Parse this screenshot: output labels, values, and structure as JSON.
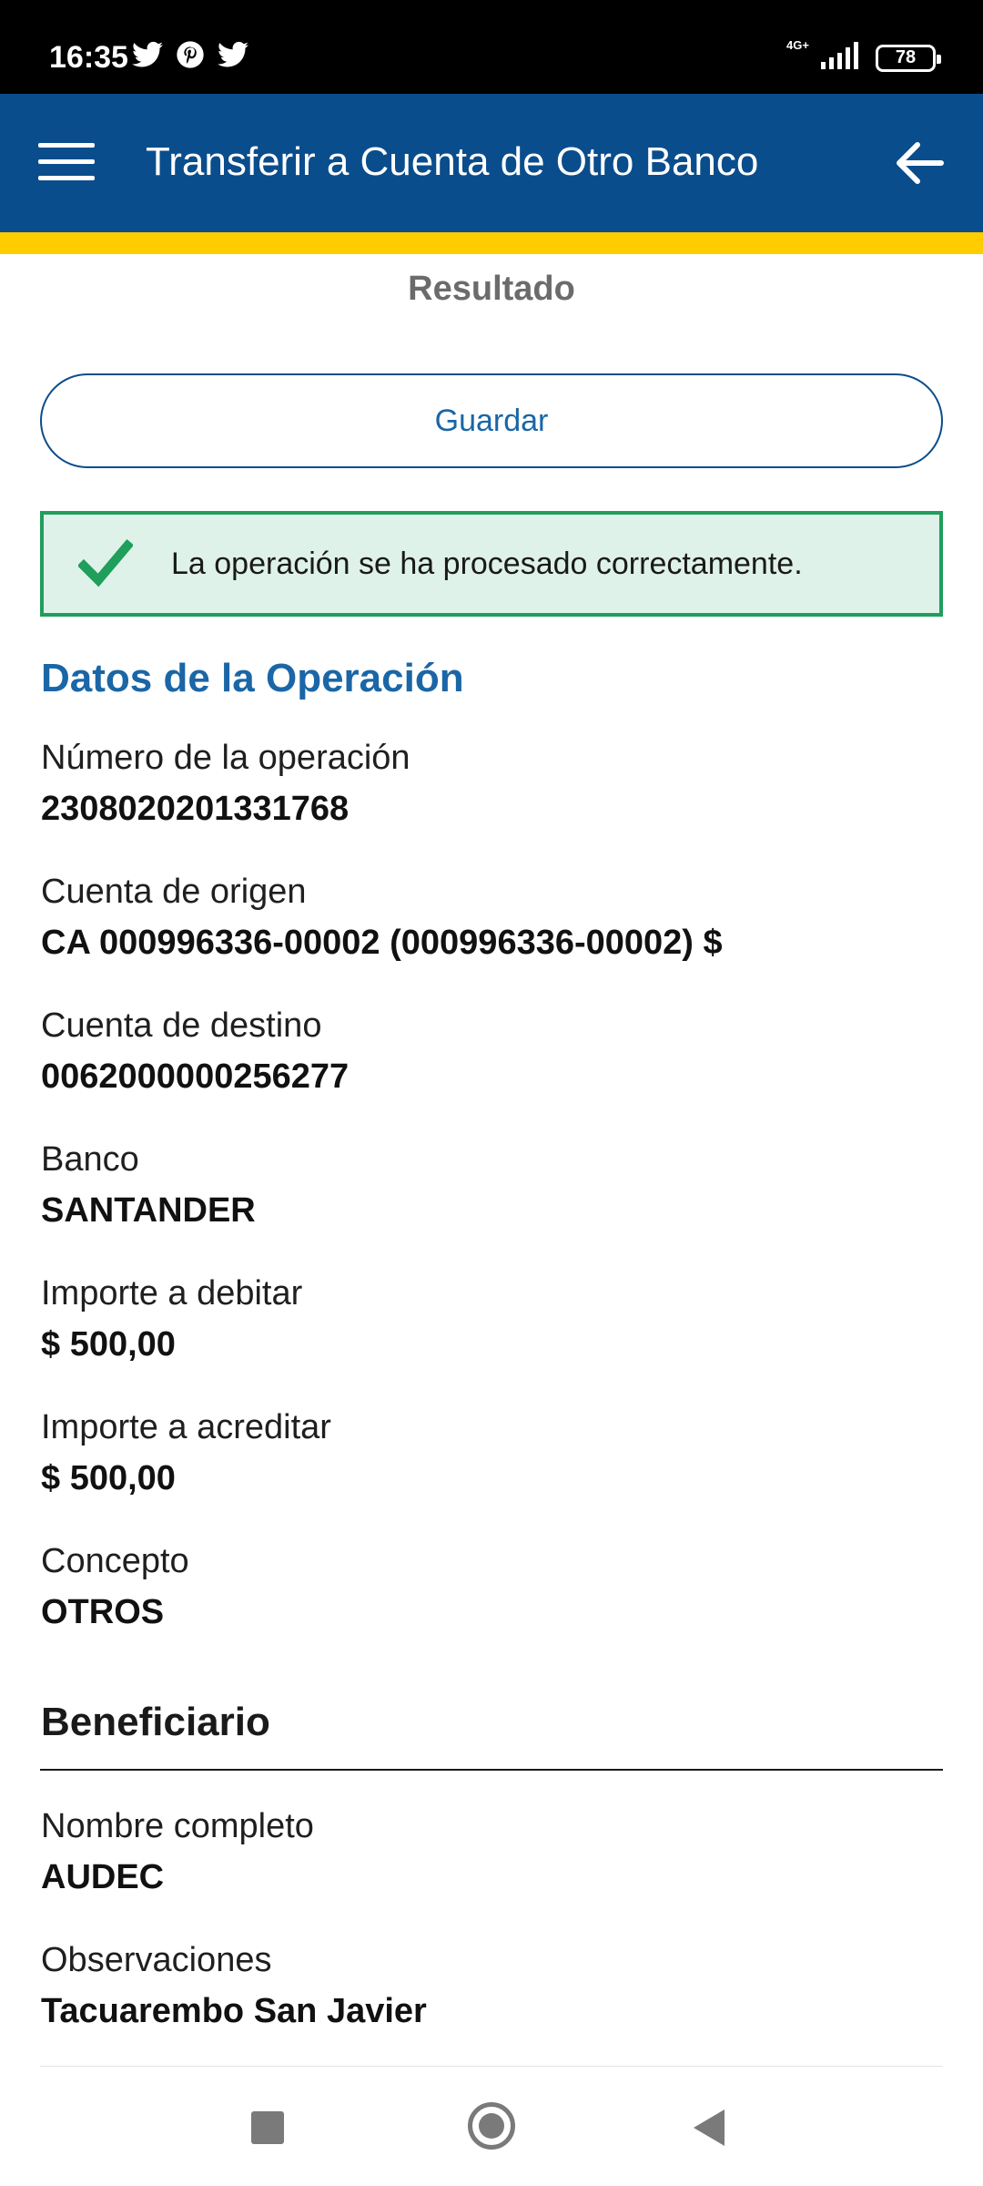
{
  "status_bar": {
    "time": "16:35",
    "network": "4G+",
    "battery": "78",
    "notifications": [
      "twitter-icon",
      "pinterest-icon",
      "twitter-icon"
    ]
  },
  "app_bar": {
    "title": "Transferir a Cuenta de Otro Banco",
    "background_color": "#0a4d8c",
    "accent_color": "#ffcc00"
  },
  "result": {
    "heading": "Resultado",
    "save_label": "Guardar",
    "success_message": "La operación se ha procesado correctamente."
  },
  "operation": {
    "title": "Datos de la Operación",
    "fields": [
      {
        "label": "Número de la operación",
        "value": "2308020201331768"
      },
      {
        "label": "Cuenta de origen",
        "value": "CA 000996336-00002 (000996336-00002) $"
      },
      {
        "label": "Cuenta de destino",
        "value": "0062000000256277"
      },
      {
        "label": "Banco",
        "value": "SANTANDER"
      },
      {
        "label": "Importe a debitar",
        "value": "$ 500,00"
      },
      {
        "label": "Importe a acreditar",
        "value": "$ 500,00"
      },
      {
        "label": "Concepto",
        "value": "OTROS"
      }
    ]
  },
  "beneficiary": {
    "title": "Beneficiario",
    "fields": [
      {
        "label": "Nombre completo",
        "value": "AUDEC"
      },
      {
        "label": "Observaciones",
        "value": "Tacuarembo San Javier"
      }
    ]
  },
  "nav_bar": {
    "buttons": [
      "recents-icon",
      "home-icon",
      "back-icon"
    ]
  }
}
